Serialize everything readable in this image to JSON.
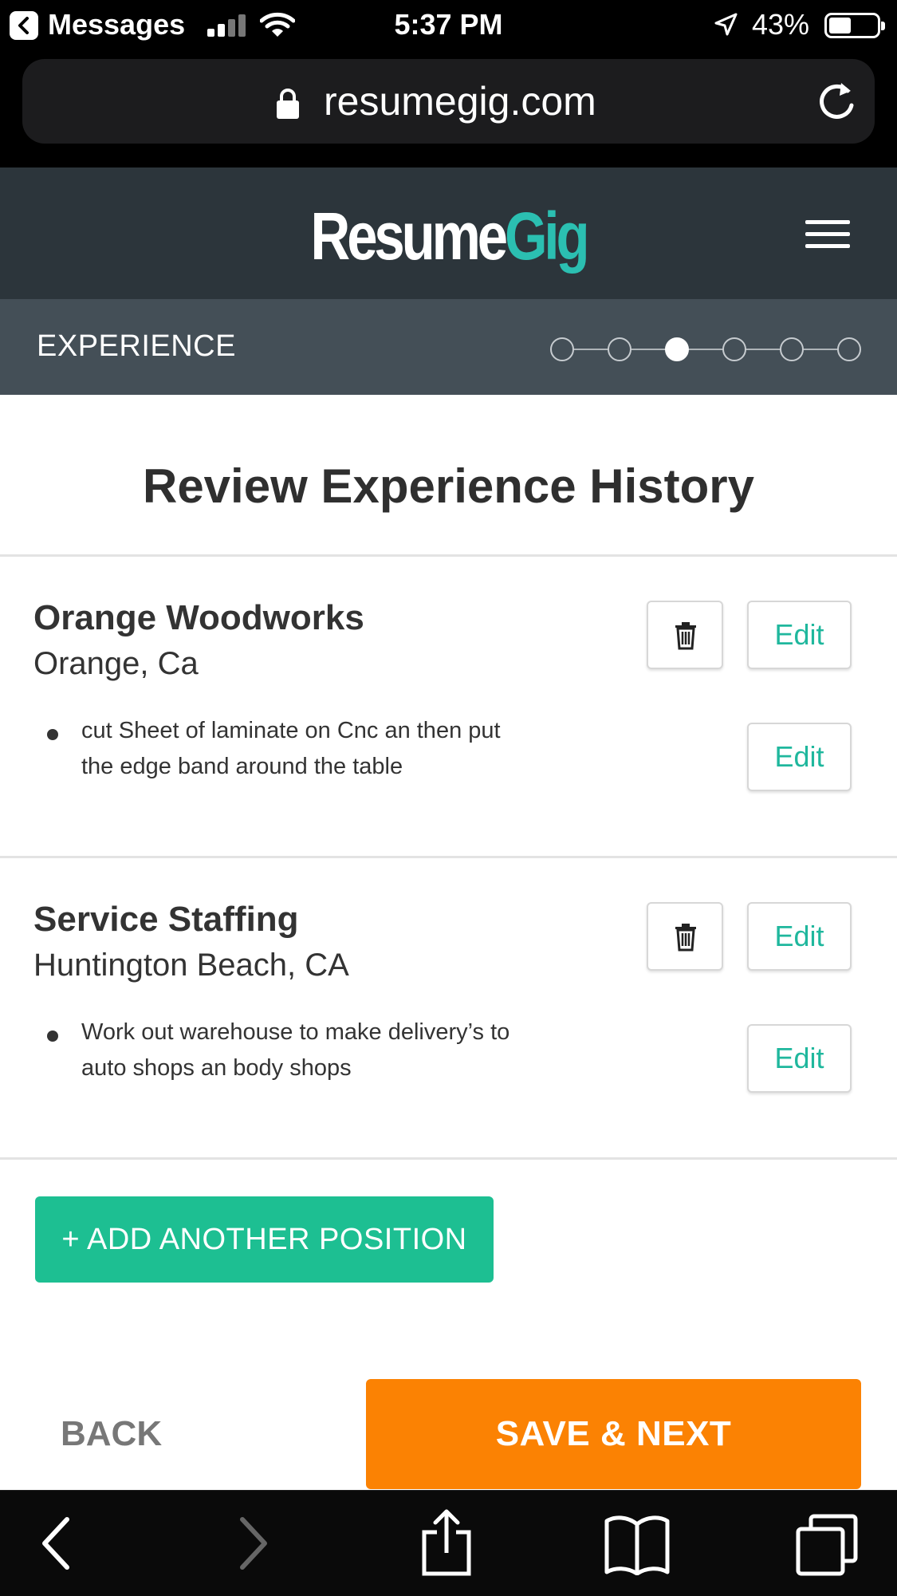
{
  "status_bar": {
    "back_app": "Messages",
    "time": "5:37 PM",
    "battery": "43%",
    "battery_level": 0.43
  },
  "browser": {
    "url": "resumegig.com"
  },
  "header": {
    "logo_part1": "Resume",
    "logo_part2": "Gig",
    "menu_icon": "hamburger-icon"
  },
  "steps": {
    "label": "EXPERIENCE",
    "total": 6,
    "current": 3
  },
  "page": {
    "title": "Review Experience History"
  },
  "jobs": [
    {
      "company": "Orange Woodworks",
      "location": "Orange, Ca",
      "bullet": "cut Sheet of laminate on  Cnc an then put the edge band around the table",
      "edit_label": "Edit",
      "bullet_edit_label": "Edit"
    },
    {
      "company": "Service Staffing",
      "location": "Huntington Beach, CA",
      "bullet": "Work out warehouse to make delivery’s to auto shops an body shops",
      "edit_label": "Edit",
      "bullet_edit_label": "Edit"
    }
  ],
  "actions": {
    "add_position": "+ ADD ANOTHER POSITION",
    "back": "BACK",
    "save_next": "SAVE & NEXT"
  },
  "colors": {
    "header_bg": "#2c353b",
    "step_bar_bg": "#444f57",
    "accent_teal": "#1dbf92",
    "edit_text": "#1fb79d",
    "save_orange": "#fb8203",
    "logo_teal": "#2bbfb1"
  },
  "toolbar": {
    "icons": [
      "back-icon",
      "forward-icon",
      "share-icon",
      "bookmarks-icon",
      "tabs-icon"
    ]
  }
}
